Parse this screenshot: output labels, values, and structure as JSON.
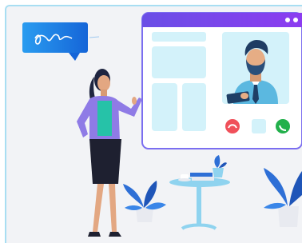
{
  "scene": {
    "description_icons": [
      "chat-bubble-icon",
      "video-call-window",
      "end-call-icon",
      "accept-call-icon",
      "plant-icon",
      "table-icon",
      "books-icon"
    ]
  },
  "colors": {
    "card_bg": "#f2f3f6",
    "card_border": "#a8def2",
    "window_header": "#5a3fdc",
    "window_accent": "#7b6ef0",
    "panel": "#d3f2fa",
    "end_call": "#f0505a",
    "accept_call": "#22b04b",
    "bubble": "#1a7ee6",
    "plant": "#2e6fd6"
  }
}
